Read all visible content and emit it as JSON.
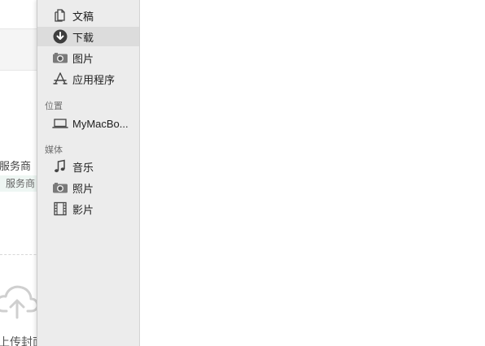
{
  "background_page": {
    "provider_label": "服务商",
    "provider_tag": "服务商",
    "upload_cover_label": "上传封面"
  },
  "sidebar": {
    "favorites": [
      {
        "label": "文稿",
        "icon": "document-icon"
      },
      {
        "label": "下载",
        "icon": "download-icon",
        "selected": true
      },
      {
        "label": "图片",
        "icon": "camera-icon"
      },
      {
        "label": "应用程序",
        "icon": "applications-icon"
      }
    ],
    "locations_header": "位置",
    "locations": [
      {
        "label": "MyMacBo...",
        "icon": "laptop-icon"
      }
    ],
    "media_header": "媒体",
    "media": [
      {
        "label": "音乐",
        "icon": "music-note-icon"
      },
      {
        "label": "照片",
        "icon": "camera-icon"
      },
      {
        "label": "影片",
        "icon": "film-icon"
      }
    ]
  },
  "colors": {
    "sidebar_bg": "#ececec",
    "selected_bg": "#dcdcdc",
    "icon": "#444444"
  }
}
